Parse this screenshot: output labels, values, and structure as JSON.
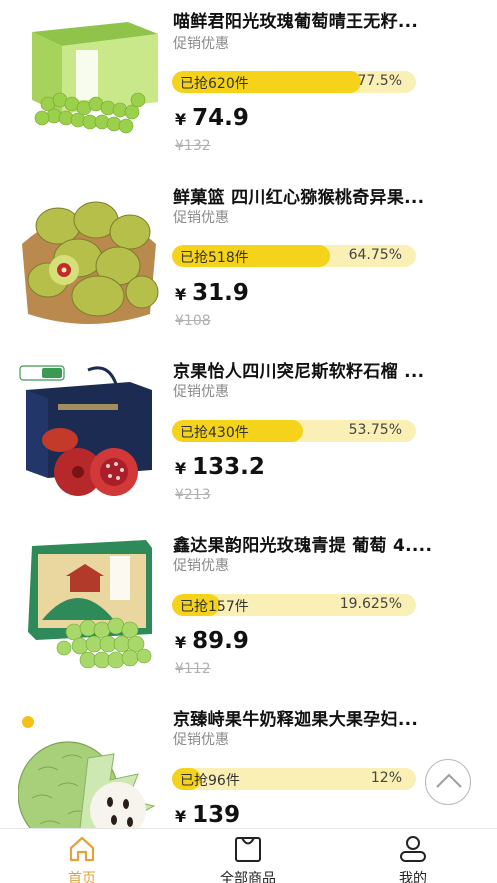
{
  "products": [
    {
      "title": "喵鲜君阳光玫瑰葡萄晴王无籽...",
      "promo": "促销优惠",
      "sold": "已抢620件",
      "percent_text": "77.5%",
      "progress": 0.775,
      "currency": "¥",
      "price": "74.9",
      "original_price": "¥132",
      "image": "green-grapes-box-image"
    },
    {
      "title": "鲜菓篮 四川红心猕猴桃奇异果...",
      "promo": "促销优惠",
      "sold": "已抢518件",
      "percent_text": "64.75%",
      "progress": 0.6475,
      "currency": "¥",
      "price": "31.9",
      "original_price": "¥108",
      "image": "kiwi-basket-image"
    },
    {
      "title": "京果怡人四川突尼斯软籽石榴 ...",
      "promo": "促销优惠",
      "sold": "已抢430件",
      "percent_text": "53.75%",
      "progress": 0.5375,
      "currency": "¥",
      "price": "133.2",
      "original_price": "¥213",
      "image": "pomegranate-gift-box-image"
    },
    {
      "title": "鑫达果韵阳光玫瑰青提 葡萄 4....",
      "promo": "促销优惠",
      "sold": "已抢157件",
      "percent_text": "19.625%",
      "progress": 0.19625,
      "currency": "¥",
      "price": "89.9",
      "original_price": "¥112",
      "image": "grape-gift-box-image"
    },
    {
      "title": "京臻峙果牛奶释迦果大果孕妇...",
      "promo": "促销优惠",
      "sold": "已抢96件",
      "percent_text": "12%",
      "progress": 0.12,
      "currency": "¥",
      "price": "139",
      "original_price": "",
      "image": "sugar-apple-image"
    }
  ],
  "tabbar": {
    "items": [
      {
        "label": "首页",
        "icon": "home-icon",
        "active": true
      },
      {
        "label": "全部商品",
        "icon": "shopping-bag-icon",
        "active": false
      },
      {
        "label": "我的",
        "icon": "user-icon",
        "active": false
      }
    ]
  },
  "scroll_top_icon": "chevron-up-icon",
  "colors": {
    "progress_fill": "#f5d31a",
    "progress_track": "#faefb5",
    "active_tab": "#e2a23c"
  }
}
